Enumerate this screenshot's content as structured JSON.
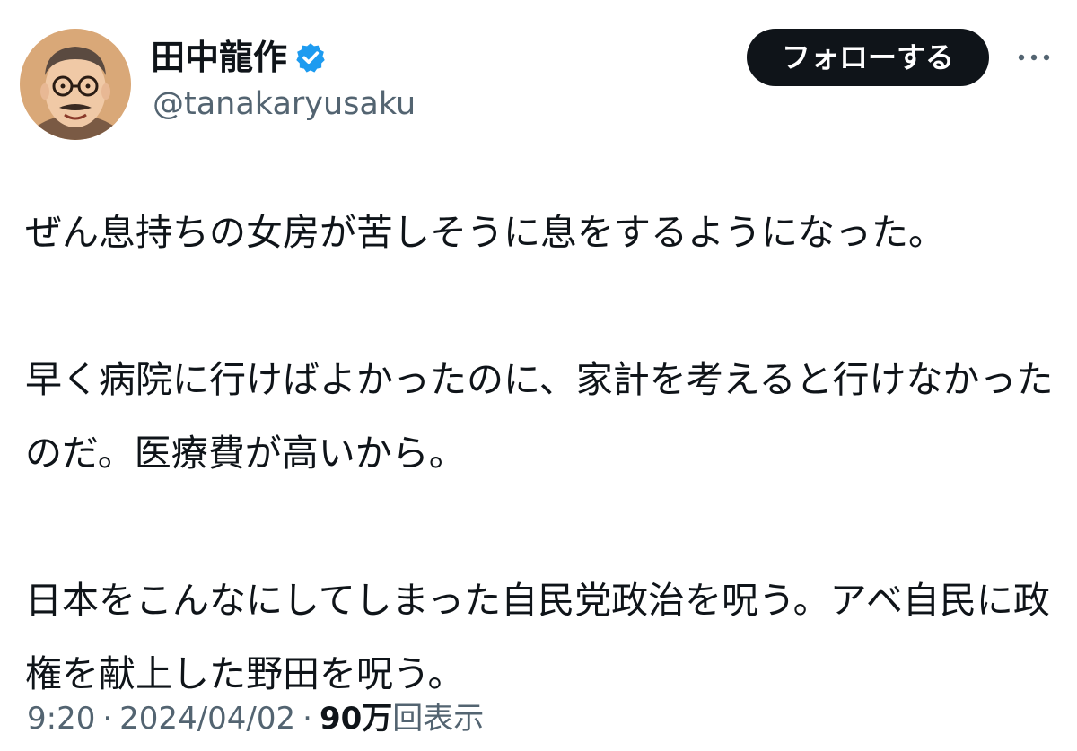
{
  "author": {
    "display_name": "田中龍作",
    "handle": "@tanakaryusaku",
    "verified": true,
    "avatar_icon": "profile-portrait-illustration"
  },
  "actions": {
    "follow_label": "フォローする",
    "more_icon": "more-horizontal-icon"
  },
  "tweet": {
    "paragraphs": [
      "ぜん息持ちの女房が苦しそうに息をするようになった。",
      "早く病院に行けばよかったのに、家計を考えると行けなかったのだ。医療費が高いから。",
      "日本をこんなにしてしまった自民党政治を呪う。アベ自民に政権を献上した野田を呪う。"
    ]
  },
  "meta": {
    "time": "9:20",
    "separator": "·",
    "date": "2024/04/02",
    "views_count": "90万",
    "views_label": "回表示"
  },
  "colors": {
    "text_primary": "#0f1419",
    "text_secondary": "#536471",
    "verified_blue": "#1d9bf0",
    "button_bg": "#0f1419",
    "button_text": "#ffffff",
    "background": "#ffffff"
  }
}
